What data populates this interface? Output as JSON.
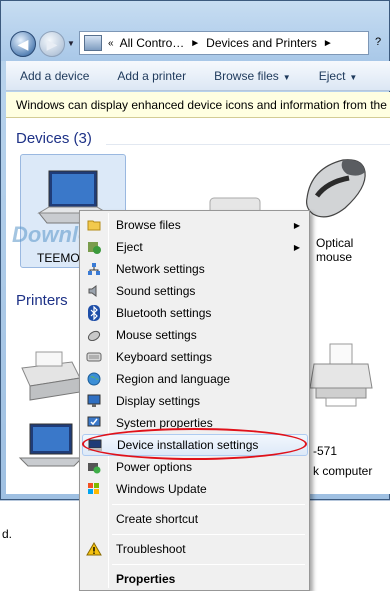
{
  "address": {
    "segments": [
      "All Contro…",
      "Devices and Printers"
    ],
    "help": "?"
  },
  "commands": [
    "Add a device",
    "Add a printer",
    "Browse files",
    "Eject"
  ],
  "infobar": "Windows can display enhanced device icons and information from the",
  "groups": {
    "devices": "Devices (3)",
    "printers": "Printers"
  },
  "devices": [
    {
      "label": "TEEMO"
    },
    {
      "label": "Optical\nmouse"
    }
  ],
  "bottom_device": {
    "line1": "-571",
    "line2": "k computer"
  },
  "left_edge_text": "d.",
  "watermark": "Download.com.vn",
  "context_menu": [
    {
      "label": "Browse files",
      "icon": "folder-icon",
      "submenu": true
    },
    {
      "label": "Eject",
      "icon": "eject-icon",
      "submenu": true
    },
    {
      "label": "Network settings",
      "icon": "network-icon"
    },
    {
      "label": "Sound settings",
      "icon": "speaker-icon"
    },
    {
      "label": "Bluetooth settings",
      "icon": "bluetooth-icon"
    },
    {
      "label": "Mouse settings",
      "icon": "mouse-icon"
    },
    {
      "label": "Keyboard settings",
      "icon": "keyboard-icon"
    },
    {
      "label": "Region and language",
      "icon": "globe-icon"
    },
    {
      "label": "Display settings",
      "icon": "monitor-icon"
    },
    {
      "label": "System properties",
      "icon": "system-icon"
    },
    {
      "label": "Device installation settings",
      "icon": "computer-icon",
      "highlighted": true
    },
    {
      "label": "Power options",
      "icon": "power-icon"
    },
    {
      "label": "Windows Update",
      "icon": "update-icon"
    },
    {
      "label": "Create shortcut"
    },
    {
      "label": "Troubleshoot",
      "icon": "warning-icon"
    },
    {
      "label": "Properties",
      "bold": true
    }
  ],
  "colors": {
    "highlight_ellipse": "#e0111a",
    "group_header": "#1e3287",
    "infobar_bg": "#ffffe1"
  }
}
